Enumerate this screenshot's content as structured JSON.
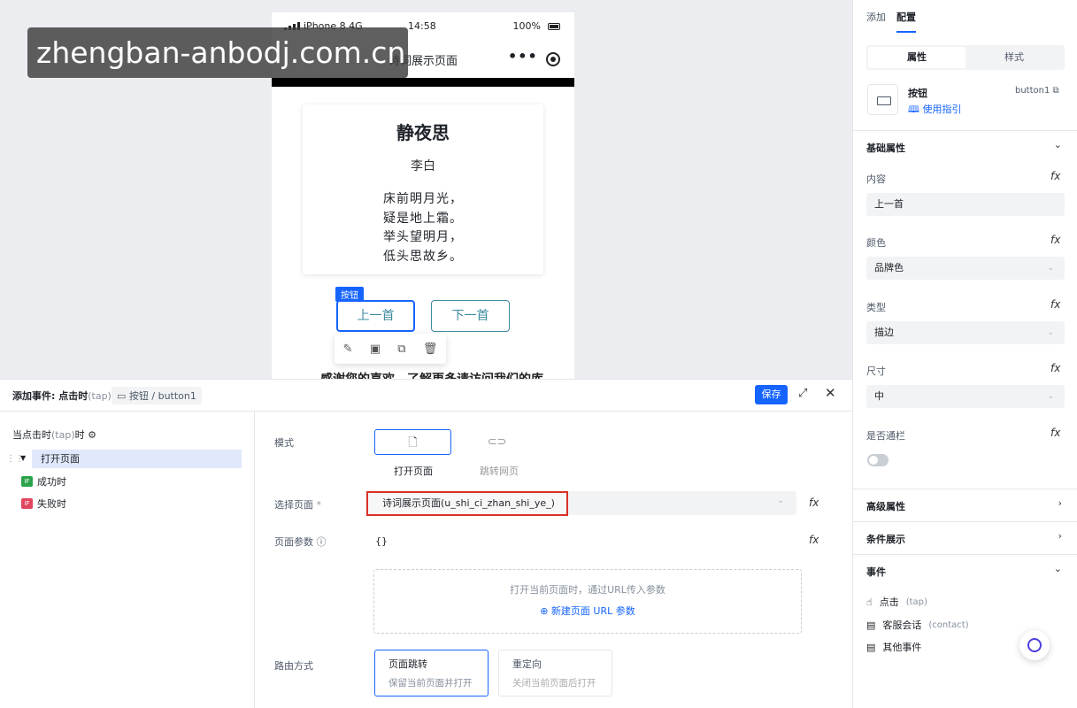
{
  "watermark": "zhengban-anbodj.com.cn",
  "phone": {
    "status": {
      "carrier": "iPhone 8  4G",
      "time": "14:58",
      "battery": "100%"
    },
    "nav_title": "诗词展示页面",
    "more": "•••",
    "poem": {
      "title": "静夜思",
      "author": "李白",
      "lines": [
        "床前明月光，",
        "疑是地上霜。",
        "举头望明月，",
        "低头思故乡。"
      ]
    },
    "tag": "按钮",
    "prev_button": "上一首",
    "next_button": "下一首",
    "cutoff_text": "感谢您的喜欢，了解更多请访问我们的库"
  },
  "event_panel": {
    "title": "添加事件: 点击时",
    "title_tag": "(tap)",
    "chip": "按钮 / button1",
    "save": "保存",
    "tree": {
      "head": "当点击时",
      "head_tag": "(tap)",
      "head_suffix": "时",
      "action": "打开页面",
      "success": "成功时",
      "fail": "失败时",
      "if_label": "IF"
    },
    "form": {
      "mode_label": "模式",
      "mode_open": "打开页面",
      "mode_jump": "跳转网页",
      "page_label": "选择页面",
      "page_value": "诗词展示页面(u_shi_ci_zhan_shi_ye_)",
      "param_label": "页面参数",
      "param_value": "{}",
      "param_hint": "打开当前页面时，通过URL传入参数",
      "param_add": "新建页面 URL 参数",
      "route_label": "路由方式",
      "route_push": "页面跳转",
      "route_push_desc": "保留当前页面并打开",
      "route_redirect": "重定向",
      "route_redirect_desc": "关闭当前页面后打开",
      "fx": "fx"
    }
  },
  "right_panel": {
    "tabs": [
      "添加",
      "配置"
    ],
    "seg": [
      "属性",
      "样式"
    ],
    "component": {
      "name": "按钮",
      "guide": "使用指引",
      "id": "button1"
    },
    "basic_title": "基础属性",
    "props": [
      {
        "label": "内容",
        "value": "上一首"
      },
      {
        "label": "颜色",
        "value": "品牌色"
      },
      {
        "label": "类型",
        "value": "描边"
      },
      {
        "label": "尺寸",
        "value": "中"
      }
    ],
    "block_label": "是否通栏",
    "advanced": "高级属性",
    "conditional": "条件展示",
    "events_title": "事件",
    "events": [
      {
        "label": "点击",
        "tag": "(tap)"
      },
      {
        "label": "客服会话",
        "tag": "(contact)"
      },
      {
        "label": "其他事件",
        "tag": ""
      }
    ],
    "fx": "fx"
  },
  "colors": {
    "brand": "#1664ff",
    "highlight_border": "#d93026",
    "button_outline": "#3c8aa0"
  }
}
